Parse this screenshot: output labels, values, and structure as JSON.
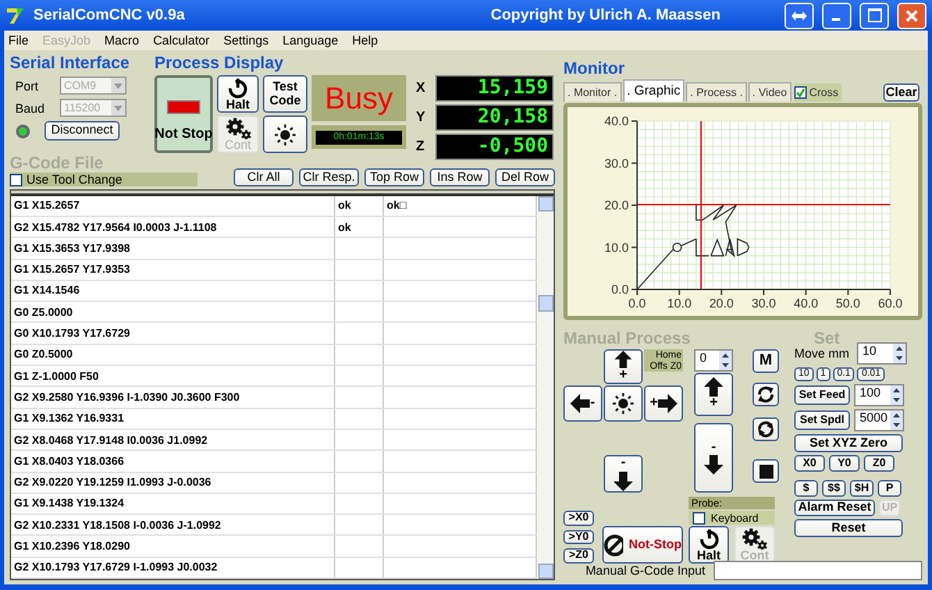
{
  "window": {
    "title": "SerialComCNC  v0.9a",
    "copyright": "Copyright by Ulrich A. Maassen"
  },
  "menu": [
    {
      "label": "File",
      "disabled": false
    },
    {
      "label": "EasyJob",
      "disabled": true
    },
    {
      "label": "Macro",
      "disabled": false
    },
    {
      "label": "Calculator",
      "disabled": false
    },
    {
      "label": "Settings",
      "disabled": false
    },
    {
      "label": "Language",
      "disabled": false
    },
    {
      "label": "Help",
      "disabled": false
    }
  ],
  "serial_interface": {
    "title": "Serial Interface",
    "port": {
      "label": "Port",
      "value": "COM9",
      "disabled": true
    },
    "baud": {
      "label": "Baud",
      "value": "115200",
      "disabled": true
    },
    "connected": true,
    "disconnect_button": "Disconnect"
  },
  "process_display": {
    "title": "Process Display",
    "not_stop_button": "Not Stop",
    "halt_button": "Halt",
    "test_code_button": "Test Code",
    "cont_button": {
      "label": "Cont",
      "disabled": true
    },
    "status": "Busy",
    "timer": "0h:01m:13s",
    "axes": [
      {
        "name": "X",
        "value": "15,159"
      },
      {
        "name": "Y",
        "value": "20,158"
      },
      {
        "name": "Z",
        "value": "-0,500"
      }
    ]
  },
  "gcode_file": {
    "title": "G-Code File",
    "tool_change": {
      "label": "Use Tool Change",
      "checked": false
    },
    "buttons": [
      "Clr All",
      "Clr Resp.",
      "Top Row",
      "Ins Row",
      "Del Row"
    ],
    "rows": [
      {
        "code": "G1 X15.2657",
        "column_2": "ok",
        "column_3": "ok□"
      },
      {
        "code": "G2 X15.4782 Y17.9564 I0.0003 J-1.1108",
        "column_2": "ok"
      },
      {
        "code": "G1 X15.3653 Y17.9398"
      },
      {
        "code": "G1 X15.2657 Y17.9353"
      },
      {
        "code": "G1 X14.1546"
      },
      {
        "code": "G0 Z5.0000"
      },
      {
        "code": "G0 X10.1793 Y17.6729"
      },
      {
        "code": "G0 Z0.5000"
      },
      {
        "code": "G1 Z-1.0000 F50"
      },
      {
        "code": "G2 X9.2580 Y16.9396 I-1.0390 J0.3600 F300"
      },
      {
        "code": "G1 X9.1362 Y16.9331"
      },
      {
        "code": "G2 X8.0468 Y17.9148 I0.0036 J1.0992"
      },
      {
        "code": "G1 X8.0403 Y18.0366"
      },
      {
        "code": "G2 X9.0220 Y19.1259 I1.0993 J-0.0036"
      },
      {
        "code": "G1 X9.1438 Y19.1324"
      },
      {
        "code": "G2 X10.2331 Y18.1508 I-0.0036 J-1.0992"
      },
      {
        "code": "G1 X10.2396 Y18.0290"
      },
      {
        "code": "G2 X10.1793 Y17.6729 I-1.0993 J0.0032"
      }
    ]
  },
  "monitor": {
    "title": "Monitor",
    "tabs": [
      {
        "label": ". Monitor .",
        "selected": false
      },
      {
        "label": ". Graphic",
        "selected": true
      },
      {
        "label": ". Process .",
        "selected": false
      },
      {
        "label": ". Video",
        "selected": false
      }
    ],
    "cross": {
      "label": "Cross",
      "checked": true
    },
    "clear_button": "Clear",
    "chart_data": {
      "type": "line",
      "xlim": [
        0,
        60
      ],
      "ylim": [
        0,
        40
      ],
      "xticks": [
        {
          "value": 0,
          "label": "0.0"
        },
        {
          "value": 10,
          "label": "10.0"
        },
        {
          "value": 20,
          "label": "20.0"
        },
        {
          "value": 30,
          "label": "30.0"
        },
        {
          "value": 40,
          "label": "40.0"
        },
        {
          "value": 50,
          "label": "50.0"
        },
        {
          "value": 60,
          "label": "60.0"
        }
      ],
      "yticks": [
        {
          "value": 0,
          "label": "0.0"
        },
        {
          "value": 10,
          "label": "10.0"
        },
        {
          "value": 20,
          "label": "20.0"
        },
        {
          "value": 30,
          "label": "30.0"
        },
        {
          "value": 40,
          "label": "40.0"
        }
      ],
      "grid": true,
      "ref_lines": [
        {
          "axis": "x",
          "value": 15.159
        },
        {
          "axis": "y",
          "value": 20.158
        }
      ]
    }
  },
  "manual_process": {
    "title": "Manual Process",
    "home_label": "Home Offs Z0",
    "home_value": "0",
    "jog": {
      "up": "+",
      "left": "-",
      "right": "+",
      "down": "-"
    },
    "z_up": "+",
    "z_down": "-",
    "m_button": "M",
    "probe_label": "Probe:",
    "keyboard": {
      "label": "Keyboard",
      "checked": false
    },
    "zero_buttons": [
      ">X0",
      ">Y0",
      ">Z0"
    ],
    "not_stop_button": "Not-Stop",
    "halt_button": "Halt",
    "cont_button": {
      "label": "Cont",
      "disabled": true
    }
  },
  "set": {
    "title": "Set",
    "move_label": "Move mm",
    "move_value": "10",
    "steps": [
      "10",
      "1",
      "0.1",
      "0.01"
    ],
    "feed": {
      "button": "Set Feed",
      "value": "100"
    },
    "spindle": {
      "button": "Set Spdl",
      "value": "5000"
    },
    "zero_button": "Set XYZ Zero",
    "axis_zero_buttons": [
      "X0",
      "Y0",
      "Z0"
    ],
    "commands": [
      "$",
      "$$",
      "$H",
      "P"
    ],
    "alarm_reset_button": "Alarm Reset",
    "up_button": {
      "label": "UP",
      "disabled": true
    },
    "reset_button": "Reset"
  },
  "manual_input": {
    "label": "Manual G-Code Input"
  }
}
